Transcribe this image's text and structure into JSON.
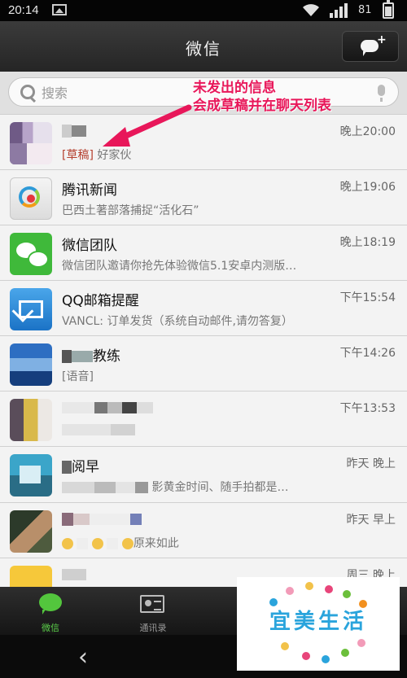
{
  "status_bar": {
    "time": "20:14",
    "battery": "81"
  },
  "header": {
    "title": "微信"
  },
  "search": {
    "placeholder": "搜索"
  },
  "annotation": {
    "line1": "未发出的信息",
    "line2": "会成草稿并在聊天列表"
  },
  "chats": [
    {
      "name": "",
      "time": "晚上20:00",
      "draft_tag": "[草稿]",
      "preview": " 好家伙"
    },
    {
      "name": "腾讯新闻",
      "time": "晚上19:06",
      "preview": "巴西土著部落捕捉“活化石”"
    },
    {
      "name": "微信团队",
      "time": "晚上18:19",
      "preview": "微信团队邀请你抢先体验微信5.1安卓内测版…"
    },
    {
      "name": "QQ邮箱提醒",
      "time": "下午15:54",
      "preview": "VANCL: 订单发货（系统自动邮件,请勿答复）"
    },
    {
      "name": "教练",
      "time": "下午14:26",
      "preview": "[语音]"
    },
    {
      "name": "",
      "time": "下午13:53",
      "preview": ""
    },
    {
      "name": "阅早",
      "time": "昨天 晚上",
      "preview": "影黄金时间、随手拍都是…"
    },
    {
      "name": "",
      "time": "昨天 早上",
      "preview": "原来如此"
    },
    {
      "name": "",
      "time": "周三 晚上",
      "preview": ""
    }
  ],
  "tabs": [
    {
      "label": "微信",
      "active": true
    },
    {
      "label": "通讯录",
      "active": false
    }
  ],
  "watermark": {
    "text": "宜美生活"
  },
  "colors": {
    "accent_green": "#5bd04a",
    "annotation_pink": "#e8175a",
    "draft_red": "#b5402f"
  }
}
